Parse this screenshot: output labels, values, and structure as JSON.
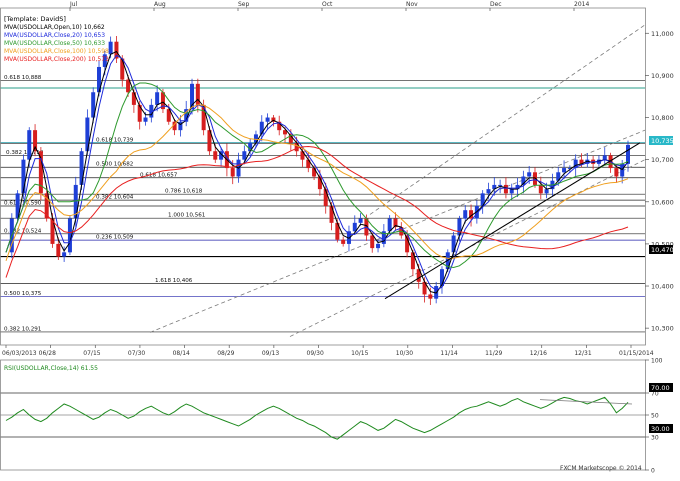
{
  "template_label": "[Template: DavidS]",
  "indicators": [
    {
      "text": "MVA(USDOLLAR,Open,10) 10,662",
      "color": "#000000"
    },
    {
      "text": "MVA(USDOLLAR,Close,20) 10,653",
      "color": "#1e2adb"
    },
    {
      "text": "MVA(USDOLLAR,Close,50) 10,633",
      "color": "#2e9a2e"
    },
    {
      "text": "MVA(USDOLLAR,Close,100) 10,598",
      "color": "#f0a020"
    },
    {
      "text": "MVA(USDOLLAR,Close,200) 10,573",
      "color": "#e82020"
    }
  ],
  "rsi_label": "RSI(USDOLLAR,Close,14) 61.55",
  "copyright": "FXCM Marketscope © 2014",
  "price_tag": "10,735",
  "support_tag": "10,470",
  "rsi_tag_70": "70.00",
  "rsi_tag_30": "30.00",
  "colors": {
    "up": "#1e3fd6",
    "down": "#d61e1e",
    "fib": "#222222",
    "fib_blue": "#2222aa",
    "cyan": "#28b8c8",
    "channel": "#7a7a7a",
    "rsi": "#1f8a1f",
    "trend": "#000000"
  },
  "chart_data": [
    {
      "type": "candlestick",
      "title": "",
      "ylim": [
        10260,
        11060
      ],
      "x_ticks": [
        "06/03/2013",
        "06/28",
        "07/15",
        "07/30",
        "08/14",
        "08/29",
        "09/13",
        "09/30",
        "10/15",
        "10/30",
        "11/14",
        "11/29",
        "12/16",
        "12/31",
        "01/15/2014"
      ],
      "month_ticks": [
        "Jul",
        "Aug",
        "Sep",
        "Oct",
        "Nov",
        "Dec",
        "2014"
      ],
      "y_ticks": [
        10300,
        10400,
        10500,
        10600,
        10700,
        10800,
        10900,
        11000
      ],
      "y_tick_labels": [
        "10,300",
        "10,400",
        "10,500",
        "10,600",
        "10,700",
        "10,800",
        "10,900",
        "11,000"
      ],
      "close_path": [
        10480,
        10560,
        10620,
        10700,
        10770,
        10720,
        10620,
        10560,
        10500,
        10470,
        10480,
        10560,
        10640,
        10720,
        10800,
        10860,
        10920,
        10950,
        10980,
        10940,
        10890,
        10860,
        10830,
        10790,
        10800,
        10830,
        10860,
        10820,
        10790,
        10770,
        10790,
        10820,
        10880,
        10830,
        10770,
        10720,
        10700,
        10720,
        10680,
        10660,
        10700,
        10720,
        10740,
        10760,
        10790,
        10800,
        10790,
        10770,
        10760,
        10740,
        10720,
        10700,
        10680,
        10660,
        10630,
        10590,
        10550,
        10510,
        10500,
        10530,
        10550,
        10560,
        10520,
        10490,
        10500,
        10530,
        10560,
        10540,
        10520,
        10480,
        10440,
        10410,
        10380,
        10370,
        10400,
        10440,
        10480,
        10520,
        10560,
        10580,
        10560,
        10590,
        10620,
        10630,
        10640,
        10640,
        10620,
        10630,
        10640,
        10660,
        10670,
        10640,
        10620,
        10630,
        10650,
        10670,
        10680,
        10680,
        10700,
        10690,
        10700,
        10690,
        10700,
        10710,
        10680,
        10660,
        10690,
        10735
      ],
      "fib_levels": [
        {
          "label": "0.618 10,888",
          "value": 10888
        },
        {
          "label": "0.618 10,739",
          "value": 10739
        },
        {
          "label": "0.382 10,710",
          "value": 10710
        },
        {
          "label": "0.500 10,682",
          "value": 10682
        },
        {
          "label": "0.618 10,657",
          "value": 10657
        },
        {
          "label": "0.382 10,604",
          "value": 10604
        },
        {
          "label": "0.786 10,618",
          "value": 10618
        },
        {
          "label": "0.618 10,590",
          "value": 10590
        },
        {
          "label": "1.000 10,561",
          "value": 10561
        },
        {
          "label": "0.382 10,524",
          "value": 10524
        },
        {
          "label": "0.236 10,509",
          "value": 10509
        },
        {
          "label": "1.618 10,406",
          "value": 10406
        },
        {
          "label": "0.500 10,375",
          "value": 10375
        },
        {
          "label": "0.382 10,291",
          "value": 10291
        }
      ],
      "horizontal_lines": [
        10870,
        10740,
        10470
      ]
    },
    {
      "type": "line",
      "title": "",
      "ylim": [
        0,
        100
      ],
      "y_ticks": [
        0,
        30,
        50,
        70,
        100
      ],
      "values": [
        45,
        48,
        52,
        55,
        50,
        46,
        44,
        47,
        52,
        56,
        60,
        58,
        55,
        52,
        49,
        46,
        48,
        52,
        55,
        53,
        50,
        47,
        49,
        53,
        56,
        58,
        55,
        52,
        50,
        53,
        57,
        60,
        58,
        55,
        52,
        50,
        48,
        46,
        44,
        42,
        40,
        43,
        46,
        50,
        53,
        56,
        58,
        56,
        53,
        50,
        47,
        45,
        42,
        40,
        37,
        34,
        30,
        28,
        32,
        36,
        40,
        44,
        42,
        39,
        36,
        38,
        42,
        46,
        44,
        41,
        38,
        36,
        34,
        36,
        39,
        42,
        45,
        48,
        52,
        55,
        57,
        58,
        60,
        62,
        60,
        58,
        60,
        63,
        65,
        62,
        60,
        58,
        56,
        58,
        61,
        64,
        66,
        65,
        63,
        62,
        60,
        62,
        64,
        66,
        60,
        52,
        56,
        61.55
      ]
    }
  ]
}
